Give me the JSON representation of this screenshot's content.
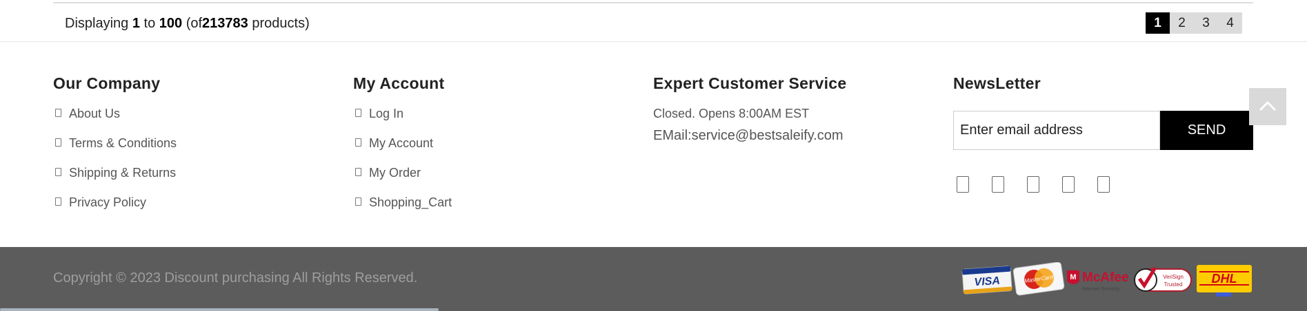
{
  "pager": {
    "prefix": "Displaying",
    "from": "1",
    "to_word": "to",
    "to": "100",
    "of_open": "(of",
    "total": "213783",
    "of_close": "products)",
    "pages": [
      "1",
      "2",
      "3",
      "4"
    ],
    "active_page": "1"
  },
  "footer": {
    "company": {
      "title": "Our Company",
      "links": [
        "About Us",
        "Terms & Conditions",
        "Shipping & Returns",
        "Privacy Policy"
      ]
    },
    "account": {
      "title": "My Account",
      "links": [
        "Log In",
        "My Account",
        "My Order",
        "Shopping_Cart"
      ]
    },
    "service": {
      "title": "Expert Customer Service",
      "hours": "Closed. Opens 8:00AM EST",
      "email_label": "EMail:",
      "email": "service@bestsaleify.com"
    },
    "newsletter": {
      "title": "NewsLetter",
      "placeholder": "Enter email address",
      "button": "SEND",
      "social_icons": [
        "facebook-icon",
        "twitter-icon",
        "pinterest-icon",
        "instagram-icon",
        "youtube-icon"
      ]
    }
  },
  "bottom": {
    "copyright": "Copyright © 2023 Discount purchasing All Rights Reserved.",
    "payment_badges": [
      "VISA",
      "MasterCard",
      "McAfee",
      "Internet Security",
      "VeriSign",
      "Trusted",
      "DHL"
    ],
    "bg_color": "#5c5c5c"
  }
}
